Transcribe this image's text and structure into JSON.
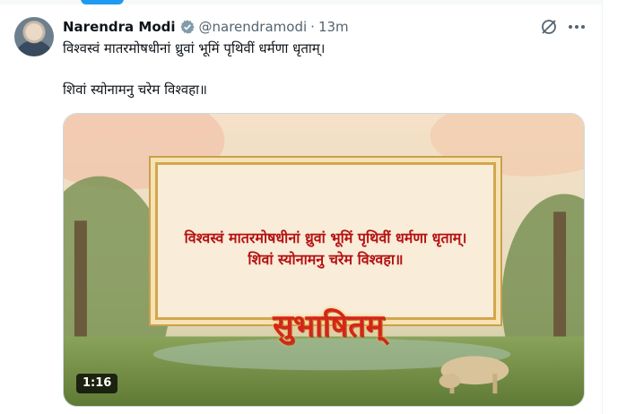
{
  "tweet": {
    "author_name": "Narendra Modi",
    "handle": "@narendramodi",
    "separator": "·",
    "time": "13m",
    "text_line1": "विश्वस्वं मातरमोषधीनां ध्रुवां भूमिं पृथिवीं धर्मणा धृताम्।",
    "text_line2": "शिवां स्योनामनु चरेम विश्वहा॥"
  },
  "media": {
    "overlay_line1": "विश्वस्वं मातरमोषधीनां ध्रुवां भूमिं पृथिवीं धर्मणा धृताम्।",
    "overlay_line2": "शिवां स्योनामनु चरेम विश्वहा॥",
    "title_art": "सुभाषितम्",
    "duration": "1:16"
  },
  "icons": {
    "verified": "verified-badge-icon",
    "grok": "grok-icon",
    "more": "more-options-icon"
  },
  "colors": {
    "verified": "#829aab",
    "text": "#0f1419",
    "muted": "#536471",
    "accent": "#1d9bf0",
    "sanskrit": "#b41212"
  }
}
